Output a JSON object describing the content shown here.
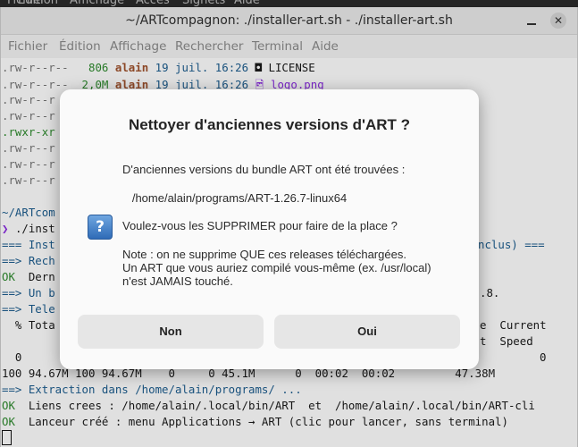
{
  "top_panel": {
    "items": [
      "Fichier",
      "Édition",
      "Affichage",
      "Accès",
      "Signets",
      "Aide"
    ]
  },
  "window": {
    "title": "~/ARTcompagnon: ./installer-art.sh - ./installer-art.sh",
    "close_glyph": "✕"
  },
  "menu": {
    "items": [
      "Fichier",
      "Édition",
      "Affichage",
      "Rechercher",
      "Terminal",
      "Aide"
    ]
  },
  "terminal": {
    "rows": [
      {
        "perm": ".rw-r--r--",
        "size": "  806",
        "user": "alain",
        "date": "19 juil. 16:26",
        "icon": "◘",
        "name": "LICENSE"
      },
      {
        "perm": ".rw-r--r--",
        "size": " 2,0M",
        "user": "alain",
        "date": "19 juil. 16:26",
        "icon": "🖻",
        "name": "logo.png"
      }
    ],
    "partial_perms": [
      ".rw-r--r",
      ".rw-r--r",
      ".rwxr-xr",
      ".rw-r--r",
      ".rw-r--r",
      ".rw-r--r"
    ],
    "prompt_path": "~/ARTcom",
    "prompt_cmd": "./inst",
    "prompt_symbol": "❯",
    "header_left": "=== Inst",
    "header_right": "nclus) ===",
    "line_rech": "==> Rech",
    "line_dern_tag": "OK",
    "line_dern": "Dern",
    "line_unb": "==> Un b",
    "line_unb_right": ".8.",
    "line_tele": "==> Tele",
    "curl_head_left": "  % Tota",
    "curl_head_right1": "e  Current",
    "curl_head_right2": "t  Speed",
    "curl_zero_left": "  0",
    "curl_zero_right": "0",
    "curl_full": "100 94.67M 100 94.67M    0     0 45.1M      0  00:02  00:02         47.38M",
    "extract": "==> Extraction dans /home/alain/programs/ ...",
    "links_tag": "OK",
    "links": "Liens crees : /home/alain/.local/bin/ART  et  /home/alain/.local/bin/ART-cli",
    "launcher_tag": "OK",
    "launcher": "Lanceur créé : menu Applications → ART (clic pour lancer, sans terminal)"
  },
  "dialog": {
    "title": "Nettoyer d'anciennes versions d'ART ?",
    "line1": "D'anciennes versions du bundle ART ont été trouvées :",
    "path": "   /home/alain/programs/ART-1.26.7-linux64",
    "question": "Voulez-vous les SUPPRIMER pour faire de la place ?",
    "note1": "Note : on ne supprime QUE ces releases téléchargées.",
    "note2": "Un ART que vous auriez compilé vous-même (ex. /usr/local)",
    "note3": "n'est JAMAIS touché.",
    "icon_glyph": "?",
    "no_label": "Non",
    "yes_label": "Oui"
  }
}
